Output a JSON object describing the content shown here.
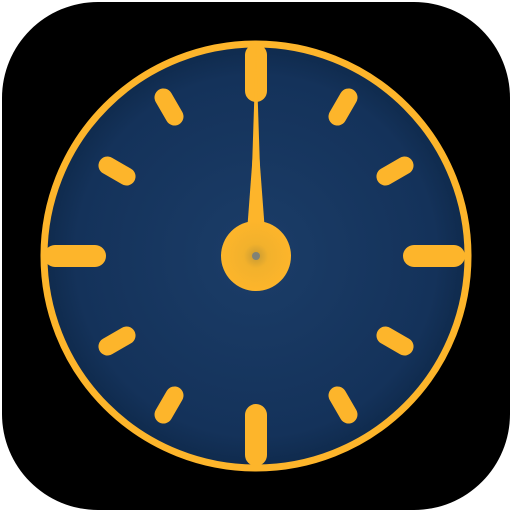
{
  "app_icon": {
    "name": "clock-app-icon",
    "background_color": "#000000",
    "face_color": "#14325a",
    "accent_color": "#fdb52b",
    "time_shown": {
      "hour": 12,
      "minute": 0
    }
  }
}
